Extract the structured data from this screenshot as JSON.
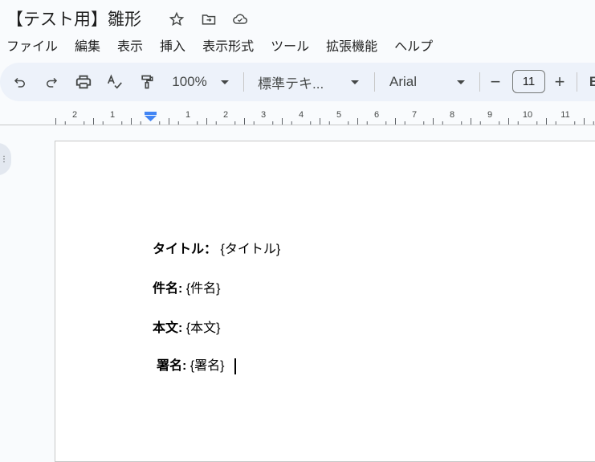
{
  "doc": {
    "title": "【テスト用】雛形"
  },
  "menu": [
    "ファイル",
    "編集",
    "表示",
    "挿入",
    "表示形式",
    "ツール",
    "拡張機能",
    "ヘルプ"
  ],
  "toolbar": {
    "zoom": "100%",
    "style": "標準テキ...",
    "font": "Arial",
    "font_size": "11",
    "minus": "−",
    "plus": "+"
  },
  "ruler": {
    "left_labels": [
      "2",
      "1"
    ],
    "right_labels": [
      "1",
      "2",
      "3",
      "4",
      "5",
      "6",
      "7",
      "8",
      "9",
      "10",
      "11"
    ]
  },
  "body": [
    {
      "label": "タイトル：",
      "value": "{タイトル}"
    },
    {
      "label": "件名:",
      "value": "{件名}"
    },
    {
      "label": "本文:",
      "value": "{本文}"
    },
    {
      "label": "署名:",
      "value": "{署名}"
    }
  ],
  "colors": {
    "accent": "#4285f4",
    "toolbar_bg": "#edf2fa"
  }
}
